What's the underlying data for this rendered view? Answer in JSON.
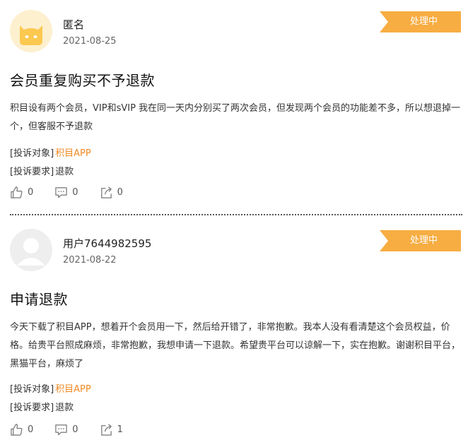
{
  "posts": [
    {
      "user": "匿名",
      "date": "2021-08-25",
      "status": "处理中",
      "title": "会员重复购买不予退款",
      "content": "积目设有两个会员，VIP和sVIP 我在同一天内分别买了两次会员，但发现两个会员的功能差不多，所以想退掉一个，但客服不予退款",
      "target_label": "[投诉对象]",
      "target_value": "积目APP",
      "request_label": "[投诉要求]",
      "request_value": "退款",
      "likes": "0",
      "comments": "0",
      "shares": "0",
      "avatar_icon": "cat-avatar-icon"
    },
    {
      "user": "用户7644982595",
      "date": "2021-08-22",
      "status": "处理中",
      "title": "申请退款",
      "content": "今天下载了积目APP，想着开个会员用一下，然后给开错了，非常抱歉。我本人没有看清楚这个会员权益，价格。给贵平台照成麻烦，非常抱歉，我想申请一下退款。希望贵平台可以谅解一下，实在抱歉。谢谢积目平台，黑猫平台，麻烦了",
      "target_label": "[投诉对象]",
      "target_value": "积目APP",
      "request_label": "[投诉要求]",
      "request_value": "退款",
      "likes": "0",
      "comments": "0",
      "shares": "1",
      "avatar_icon": "default-user-avatar-icon"
    }
  ],
  "colors": {
    "status_bg": "#f7ad42",
    "target_link": "#f08a24"
  }
}
